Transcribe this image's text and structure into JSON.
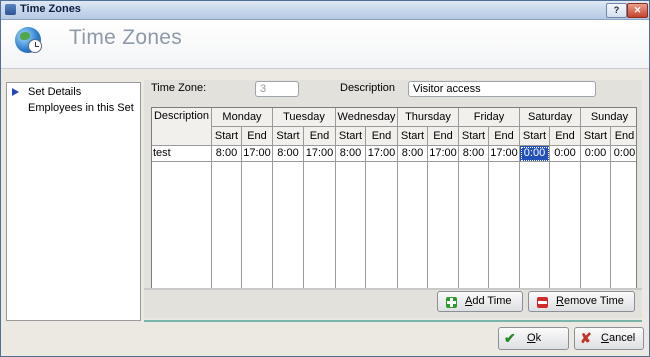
{
  "window": {
    "title": "Time Zones",
    "help_glyph": "?",
    "close_glyph": "✕"
  },
  "header": {
    "title": "Time Zones"
  },
  "sidebar": {
    "items": [
      {
        "label": "Set Details",
        "selected": true
      },
      {
        "label": "Employees in this Set",
        "selected": false
      }
    ]
  },
  "form": {
    "timezone_label": "Time Zone:",
    "timezone_value": "3",
    "description_label": "Description",
    "description_value": "Visitor access"
  },
  "grid": {
    "description_header": "Description",
    "start_label": "Start",
    "end_label": "End",
    "days": [
      "Monday",
      "Tuesday",
      "Wednesday",
      "Thursday",
      "Friday",
      "Saturday",
      "Sunday"
    ],
    "rows": [
      {
        "description": "test",
        "times": [
          "8:00",
          "17:00",
          "8:00",
          "17:00",
          "8:00",
          "17:00",
          "8:00",
          "17:00",
          "8:00",
          "17:00",
          "0:00",
          "0:00",
          "0:00",
          "0:00"
        ]
      }
    ],
    "selected_cell": "Saturday Start"
  },
  "buttons": {
    "add_time_pre": "",
    "add_time_u": "A",
    "add_time_post": "dd Time",
    "remove_time_pre": "",
    "remove_time_u": "R",
    "remove_time_post": "emove Time",
    "ok_pre": "",
    "ok_u": "O",
    "ok_post": "k",
    "cancel_pre": "",
    "cancel_u": "C",
    "cancel_post": "ancel"
  },
  "colors": {
    "selection": "#2451b8",
    "nav_arrow": "#2a45b8",
    "add_icon": "#2f9b2f",
    "remove_icon": "#cf2b2b"
  }
}
